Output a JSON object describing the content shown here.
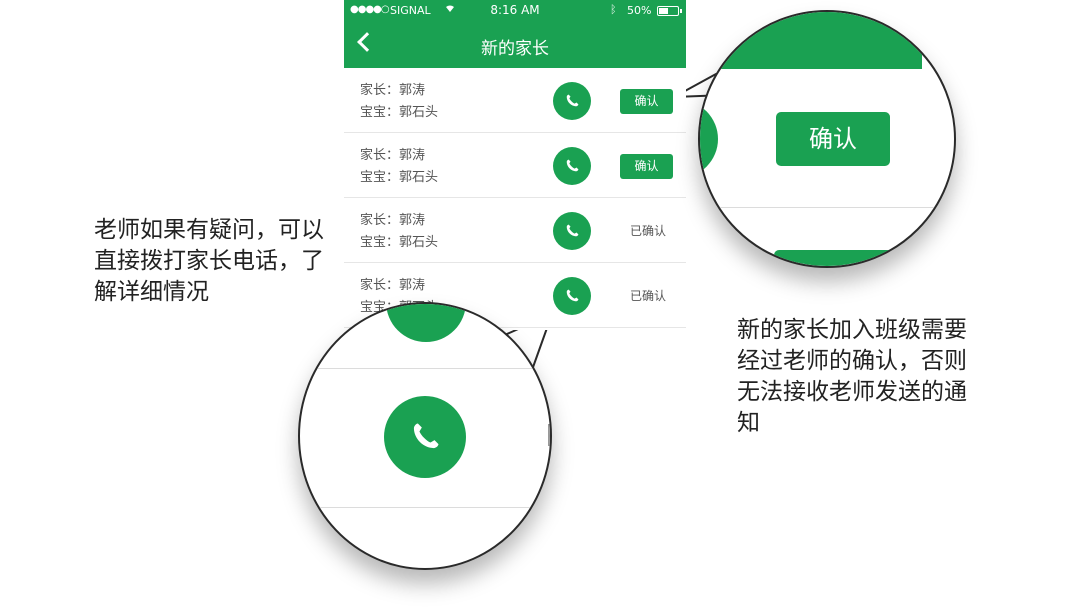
{
  "status_bar": {
    "dots": "●●●●○",
    "carrier": "SIGNAL",
    "wifi_icon": "wifi-icon",
    "time": "8:16 AM",
    "bluetooth_icon": "bluetooth-icon",
    "battery_percent": "50%",
    "battery_level": 0.5
  },
  "nav": {
    "back_icon": "chevron-left-icon",
    "title": "新的家长"
  },
  "rows": [
    {
      "parent": "家长：郭涛",
      "child": "宝宝：郭石头",
      "action": "确认",
      "confirmed": false
    },
    {
      "parent": "家长：郭涛",
      "child": "宝宝：郭石头",
      "action": "确认",
      "confirmed": false
    },
    {
      "parent": "家长：郭涛",
      "child": "宝宝：郭石头",
      "action": "已确认",
      "confirmed": true
    },
    {
      "parent": "家长：郭涛",
      "child": "宝宝：郭石头",
      "action": "已确认",
      "confirmed": true
    }
  ],
  "annotations": {
    "left": "老师如果有疑问，可以直接拨打家长电话，了解详细情况",
    "right": "新的家长加入班级需要经过老师的确认，否则无法接收老师发送的通知"
  },
  "magnifier_right": {
    "button_label": "确认"
  },
  "colors": {
    "brand_green": "#1aa152",
    "text_gray": "#555555",
    "divider": "#e6e6e6"
  }
}
